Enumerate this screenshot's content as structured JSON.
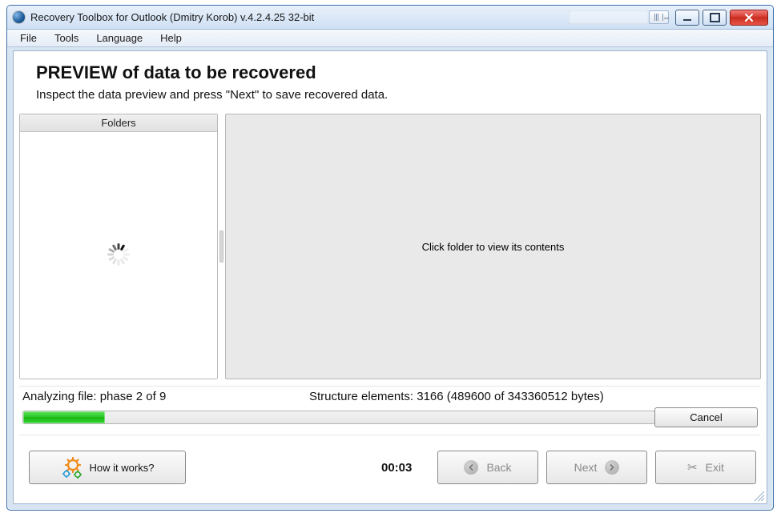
{
  "window": {
    "title": "Recovery Toolbox for Outlook (Dmitry Korob) v.4.2.4.25 32-bit"
  },
  "menu": {
    "file": "File",
    "tools": "Tools",
    "language": "Language",
    "help": "Help"
  },
  "main": {
    "heading": "PREVIEW of data to be recovered",
    "subheading": "Inspect the data preview and press \"Next\" to save recovered data.",
    "folders_header": "Folders",
    "right_placeholder": "Click folder to view its contents"
  },
  "progress": {
    "left_label": "Analyzing file: phase 2 of 9",
    "right_label": "Structure elements: 3166 (489600 of 343360512 bytes)",
    "percent": 13,
    "cancel": "Cancel"
  },
  "bottom": {
    "how": "How it works?",
    "timer": "00:03",
    "back": "Back",
    "next": "Next",
    "exit": "Exit"
  }
}
